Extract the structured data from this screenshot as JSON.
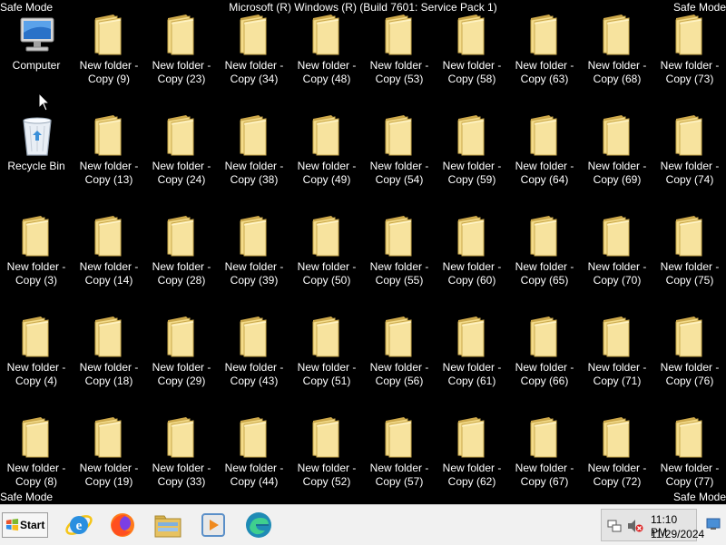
{
  "safe_mode": {
    "tl": "Safe Mode",
    "tr": "Safe Mode",
    "bl": "Safe Mode",
    "br": "Safe Mode"
  },
  "os_title": "Microsoft (R) Windows (R) (Build 7601: Service Pack 1)",
  "system_icons": [
    {
      "label": "Computer",
      "icon": "computer-icon"
    },
    {
      "label": "Recycle Bin",
      "icon": "recycle-bin-icon"
    }
  ],
  "folder_grid": [
    [
      "",
      "New folder -\nCopy (9)",
      "New folder -\nCopy (23)",
      "New folder -\nCopy (34)",
      "New folder -\nCopy (48)",
      "New folder -\nCopy (53)",
      "New folder -\nCopy (58)",
      "New folder -\nCopy (63)",
      "New folder -\nCopy (68)",
      "New folder -\nCopy (73)"
    ],
    [
      "",
      "New folder -\nCopy (13)",
      "New folder -\nCopy (24)",
      "New folder -\nCopy (38)",
      "New folder -\nCopy (49)",
      "New folder -\nCopy (54)",
      "New folder -\nCopy (59)",
      "New folder -\nCopy (64)",
      "New folder -\nCopy (69)",
      "New folder -\nCopy (74)"
    ],
    [
      "New folder -\nCopy (3)",
      "New folder -\nCopy (14)",
      "New folder -\nCopy (28)",
      "New folder -\nCopy (39)",
      "New folder -\nCopy (50)",
      "New folder -\nCopy (55)",
      "New folder -\nCopy (60)",
      "New folder -\nCopy (65)",
      "New folder -\nCopy (70)",
      "New folder -\nCopy (75)"
    ],
    [
      "New folder -\nCopy (4)",
      "New folder -\nCopy (18)",
      "New folder -\nCopy (29)",
      "New folder -\nCopy (43)",
      "New folder -\nCopy (51)",
      "New folder -\nCopy (56)",
      "New folder -\nCopy (61)",
      "New folder -\nCopy (66)",
      "New folder -\nCopy (71)",
      "New folder -\nCopy (76)"
    ],
    [
      "New folder -\nCopy (8)",
      "New folder -\nCopy (19)",
      "New folder -\nCopy (33)",
      "New folder -\nCopy (44)",
      "New folder -\nCopy (52)",
      "New folder -\nCopy (57)",
      "New folder -\nCopy (62)",
      "New folder -\nCopy (67)",
      "New folder -\nCopy (72)",
      "New folder -\nCopy (77)"
    ]
  ],
  "taskbar": {
    "start_label": "Start",
    "pinned": [
      "internet-explorer-icon",
      "firefox-icon",
      "windows-explorer-icon",
      "media-player-icon",
      "edge-icon"
    ],
    "tray": {
      "time": "11:10 PM",
      "date": "11/29/2024",
      "icons": [
        "network-icon",
        "volume-muted-icon"
      ]
    }
  },
  "colors": {
    "desktop": "#000000",
    "folder": "#f0d27a",
    "taskbar": "#f1f1f1"
  }
}
